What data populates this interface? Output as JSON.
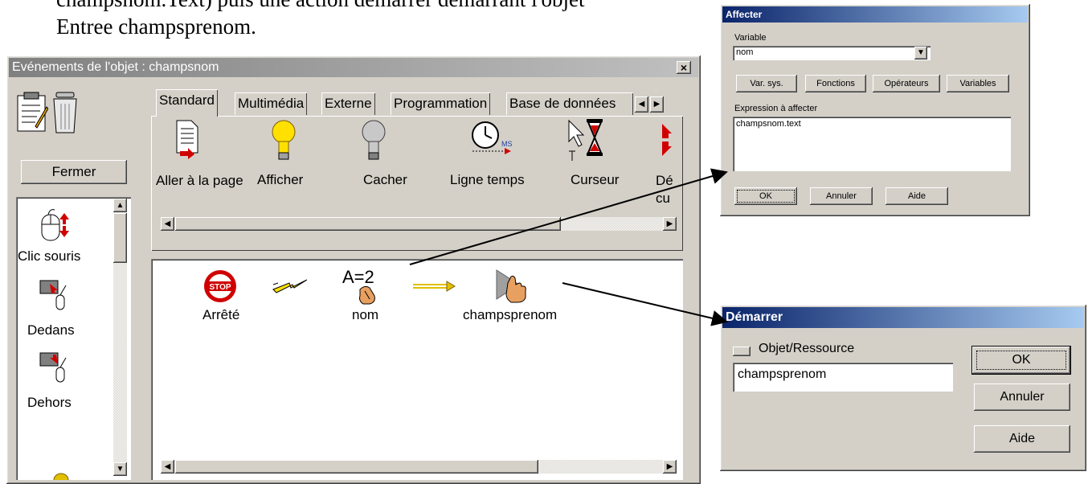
{
  "document": {
    "line1": "champsnom.Text) puis une action démarrer démarrant l'objet",
    "line2": "Entree champsprenom."
  },
  "events_window": {
    "title": "Evénements de l'objet : champsnom",
    "close_button": "×",
    "close_label": "Fermer",
    "tabs": [
      "Standard",
      "Multimédia",
      "Externe",
      "Programmation",
      "Base de données"
    ],
    "actions": [
      {
        "label": "Aller à la page",
        "icon": "page-arrow-icon"
      },
      {
        "label": "Afficher",
        "icon": "lightbulb-on-icon"
      },
      {
        "label": "Cacher",
        "icon": "lightbulb-off-icon"
      },
      {
        "label": "Ligne temps",
        "icon": "clock-timeline-icon"
      },
      {
        "label": "Curseur",
        "icon": "cursor-hourglass-icon"
      },
      {
        "label": "Dé cu",
        "icon": "start-icon"
      }
    ],
    "events": [
      {
        "label": "Clic souris",
        "icon": "mouse-click-icon"
      },
      {
        "label": "Dedans",
        "icon": "mouse-in-icon"
      },
      {
        "label": "Dehors",
        "icon": "mouse-out-icon"
      }
    ],
    "sequence": [
      {
        "label": "Arrêté",
        "icon": "stop-sign-icon"
      },
      {
        "label": "",
        "icon": "lightning-icon"
      },
      {
        "label": "nom",
        "icon": "assign-icon"
      },
      {
        "label": "",
        "icon": "arrow-right-icon"
      },
      {
        "label": "champsprenom",
        "icon": "start-hand-icon"
      }
    ],
    "stop_text": "STOP",
    "assign_text": "A=2"
  },
  "affecter_dialog": {
    "title": "Affecter",
    "variable_label": "Variable",
    "variable_value": "nom",
    "buttons": [
      "Var. sys.",
      "Fonctions",
      "Opérateurs",
      "Variables"
    ],
    "expression_label": "Expression à affecter",
    "expression_value": "champsnom.text",
    "ok": "OK",
    "cancel": "Annuler",
    "help": "Aide"
  },
  "demarrer_dialog": {
    "title": "Démarrer",
    "checkbox_label": "Objet/Ressource",
    "value": "champsprenom",
    "ok": "OK",
    "cancel": "Annuler",
    "help": "Aide"
  }
}
